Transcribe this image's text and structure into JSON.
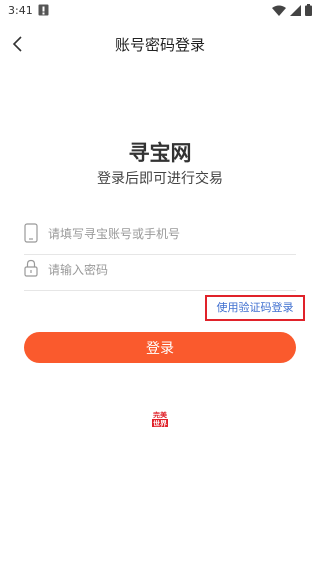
{
  "status_bar": {
    "time": "3:41",
    "icons": [
      "sim-alert-icon",
      "wifi-icon",
      "signal-icon",
      "battery-icon"
    ]
  },
  "header": {
    "title": "账号密码登录",
    "back_icon": "chevron-left-icon"
  },
  "brand": {
    "name": "寻宝网",
    "subtitle": "登录后即可进行交易"
  },
  "form": {
    "phone_placeholder": "请填写寻宝账号或手机号",
    "phone_value": "",
    "phone_icon": "phone-icon",
    "password_placeholder": "请输入密码",
    "password_value": "",
    "password_icon": "lock-icon",
    "sms_login_link": "使用验证码登录",
    "login_button": "登录"
  },
  "footer": {
    "logo_text": "完美世界",
    "logo_icon": "perfect-world-logo"
  },
  "colors": {
    "accent": "#fa5a2d",
    "link": "#3f6fd0",
    "highlight_border": "#e0222a",
    "logo": "#e0222a"
  }
}
